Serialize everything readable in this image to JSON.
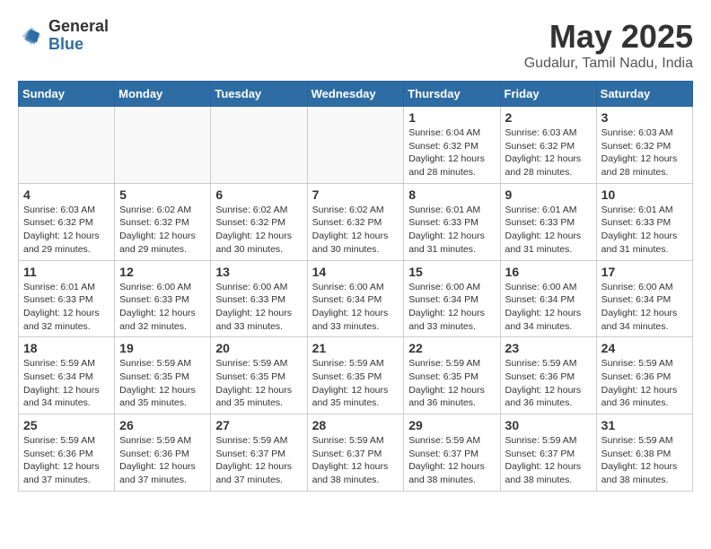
{
  "header": {
    "logo_general": "General",
    "logo_blue": "Blue",
    "title": "May 2025",
    "location": "Gudalur, Tamil Nadu, India"
  },
  "weekdays": [
    "Sunday",
    "Monday",
    "Tuesday",
    "Wednesday",
    "Thursday",
    "Friday",
    "Saturday"
  ],
  "weeks": [
    [
      {
        "day": "",
        "info": ""
      },
      {
        "day": "",
        "info": ""
      },
      {
        "day": "",
        "info": ""
      },
      {
        "day": "",
        "info": ""
      },
      {
        "day": "1",
        "info": "Sunrise: 6:04 AM\nSunset: 6:32 PM\nDaylight: 12 hours\nand 28 minutes."
      },
      {
        "day": "2",
        "info": "Sunrise: 6:03 AM\nSunset: 6:32 PM\nDaylight: 12 hours\nand 28 minutes."
      },
      {
        "day": "3",
        "info": "Sunrise: 6:03 AM\nSunset: 6:32 PM\nDaylight: 12 hours\nand 28 minutes."
      }
    ],
    [
      {
        "day": "4",
        "info": "Sunrise: 6:03 AM\nSunset: 6:32 PM\nDaylight: 12 hours\nand 29 minutes."
      },
      {
        "day": "5",
        "info": "Sunrise: 6:02 AM\nSunset: 6:32 PM\nDaylight: 12 hours\nand 29 minutes."
      },
      {
        "day": "6",
        "info": "Sunrise: 6:02 AM\nSunset: 6:32 PM\nDaylight: 12 hours\nand 30 minutes."
      },
      {
        "day": "7",
        "info": "Sunrise: 6:02 AM\nSunset: 6:32 PM\nDaylight: 12 hours\nand 30 minutes."
      },
      {
        "day": "8",
        "info": "Sunrise: 6:01 AM\nSunset: 6:33 PM\nDaylight: 12 hours\nand 31 minutes."
      },
      {
        "day": "9",
        "info": "Sunrise: 6:01 AM\nSunset: 6:33 PM\nDaylight: 12 hours\nand 31 minutes."
      },
      {
        "day": "10",
        "info": "Sunrise: 6:01 AM\nSunset: 6:33 PM\nDaylight: 12 hours\nand 31 minutes."
      }
    ],
    [
      {
        "day": "11",
        "info": "Sunrise: 6:01 AM\nSunset: 6:33 PM\nDaylight: 12 hours\nand 32 minutes."
      },
      {
        "day": "12",
        "info": "Sunrise: 6:00 AM\nSunset: 6:33 PM\nDaylight: 12 hours\nand 32 minutes."
      },
      {
        "day": "13",
        "info": "Sunrise: 6:00 AM\nSunset: 6:33 PM\nDaylight: 12 hours\nand 33 minutes."
      },
      {
        "day": "14",
        "info": "Sunrise: 6:00 AM\nSunset: 6:34 PM\nDaylight: 12 hours\nand 33 minutes."
      },
      {
        "day": "15",
        "info": "Sunrise: 6:00 AM\nSunset: 6:34 PM\nDaylight: 12 hours\nand 33 minutes."
      },
      {
        "day": "16",
        "info": "Sunrise: 6:00 AM\nSunset: 6:34 PM\nDaylight: 12 hours\nand 34 minutes."
      },
      {
        "day": "17",
        "info": "Sunrise: 6:00 AM\nSunset: 6:34 PM\nDaylight: 12 hours\nand 34 minutes."
      }
    ],
    [
      {
        "day": "18",
        "info": "Sunrise: 5:59 AM\nSunset: 6:34 PM\nDaylight: 12 hours\nand 34 minutes."
      },
      {
        "day": "19",
        "info": "Sunrise: 5:59 AM\nSunset: 6:35 PM\nDaylight: 12 hours\nand 35 minutes."
      },
      {
        "day": "20",
        "info": "Sunrise: 5:59 AM\nSunset: 6:35 PM\nDaylight: 12 hours\nand 35 minutes."
      },
      {
        "day": "21",
        "info": "Sunrise: 5:59 AM\nSunset: 6:35 PM\nDaylight: 12 hours\nand 35 minutes."
      },
      {
        "day": "22",
        "info": "Sunrise: 5:59 AM\nSunset: 6:35 PM\nDaylight: 12 hours\nand 36 minutes."
      },
      {
        "day": "23",
        "info": "Sunrise: 5:59 AM\nSunset: 6:36 PM\nDaylight: 12 hours\nand 36 minutes."
      },
      {
        "day": "24",
        "info": "Sunrise: 5:59 AM\nSunset: 6:36 PM\nDaylight: 12 hours\nand 36 minutes."
      }
    ],
    [
      {
        "day": "25",
        "info": "Sunrise: 5:59 AM\nSunset: 6:36 PM\nDaylight: 12 hours\nand 37 minutes."
      },
      {
        "day": "26",
        "info": "Sunrise: 5:59 AM\nSunset: 6:36 PM\nDaylight: 12 hours\nand 37 minutes."
      },
      {
        "day": "27",
        "info": "Sunrise: 5:59 AM\nSunset: 6:37 PM\nDaylight: 12 hours\nand 37 minutes."
      },
      {
        "day": "28",
        "info": "Sunrise: 5:59 AM\nSunset: 6:37 PM\nDaylight: 12 hours\nand 38 minutes."
      },
      {
        "day": "29",
        "info": "Sunrise: 5:59 AM\nSunset: 6:37 PM\nDaylight: 12 hours\nand 38 minutes."
      },
      {
        "day": "30",
        "info": "Sunrise: 5:59 AM\nSunset: 6:37 PM\nDaylight: 12 hours\nand 38 minutes."
      },
      {
        "day": "31",
        "info": "Sunrise: 5:59 AM\nSunset: 6:38 PM\nDaylight: 12 hours\nand 38 minutes."
      }
    ]
  ]
}
